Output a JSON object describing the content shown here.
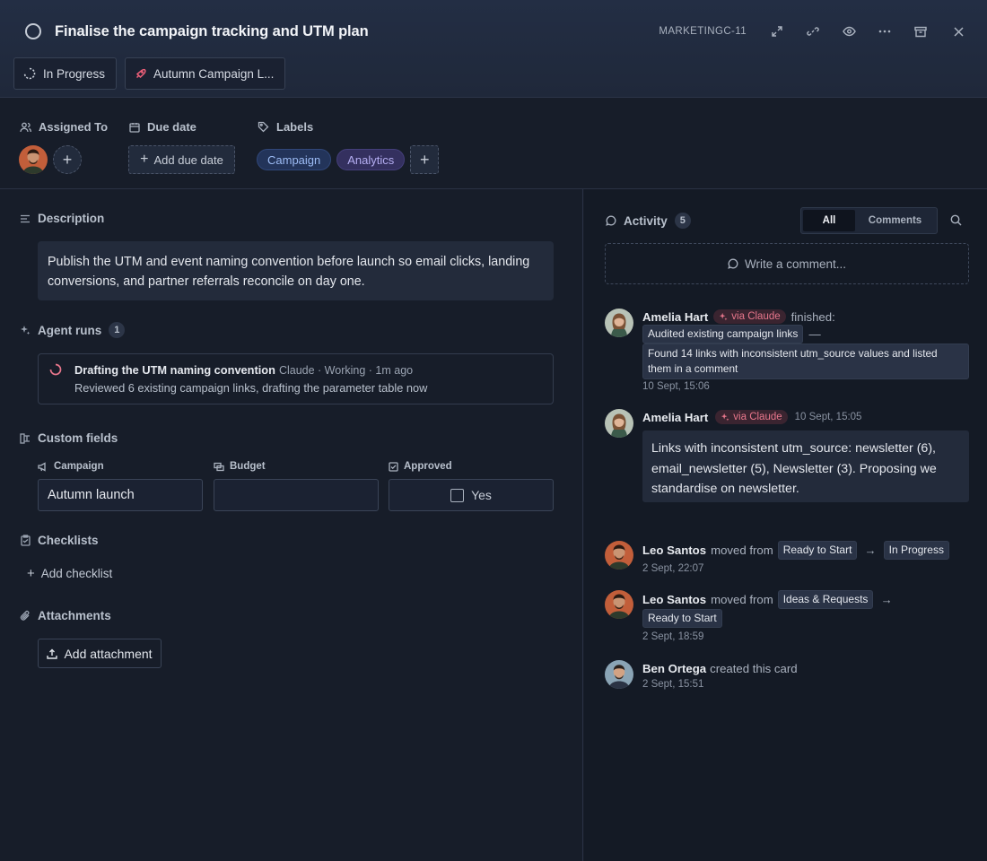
{
  "header": {
    "title": "Finalise the campaign tracking and UTM plan",
    "card_id": "MARKETINGC-11",
    "chips": [
      {
        "label": "In Progress",
        "icon": "progress-icon"
      },
      {
        "label": "Autumn Campaign L...",
        "icon": "rocket-icon",
        "icon_color": "#f0607a"
      }
    ]
  },
  "meta": {
    "assigned_label": "Assigned To",
    "due_label": "Due date",
    "due_button": "Add due date",
    "labels_label": "Labels",
    "labels": [
      {
        "text": "Campaign",
        "bg": "#23345a",
        "fg": "#9dbcf5"
      },
      {
        "text": "Analytics",
        "bg": "#34305f",
        "fg": "#b5aef2"
      }
    ]
  },
  "description": {
    "heading": "Description",
    "text": "Publish the UTM and event naming convention before launch so email clicks, landing conversions, and partner referrals reconcile on day one."
  },
  "agent_runs": {
    "heading": "Agent runs",
    "count": "1",
    "run": {
      "title": "Drafting the UTM naming convention",
      "meta": "Claude · Working · 1m ago",
      "detail": "Reviewed 6 existing campaign links, drafting the parameter table now"
    }
  },
  "custom_fields": {
    "heading": "Custom fields",
    "campaign_label": "Campaign",
    "campaign_value": "Autumn launch",
    "budget_label": "Budget",
    "budget_value": "",
    "approved_label": "Approved",
    "approved_text": "Yes"
  },
  "checklists": {
    "heading": "Checklists",
    "add": "Add checklist"
  },
  "attachments": {
    "heading": "Attachments",
    "add": "Add attachment"
  },
  "activity": {
    "heading": "Activity",
    "count": "5",
    "tab_all": "All",
    "tab_comments": "Comments",
    "write_placeholder": "Write a comment...",
    "items": [
      {
        "name": "Amelia Hart",
        "via": "via Claude",
        "action": "finished:",
        "tag1": "Audited existing campaign links",
        "dash": "—",
        "tag2": "Found 14 links with inconsistent utm_source values and listed them in a comment",
        "time": "10 Sept, 15:06"
      },
      {
        "name": "Amelia Hart",
        "via": "via Claude",
        "time": "10 Sept, 15:05",
        "comment": "Links with inconsistent utm_source: newsletter (6), email_newsletter (5), Newsletter (3). Proposing we standardise on newsletter."
      },
      {
        "name": "Leo Santos",
        "action": "moved from",
        "from": "Ready to Start",
        "arrow": "→",
        "to": "In Progress",
        "time": "2 Sept, 22:07"
      },
      {
        "name": "Leo Santos",
        "action": "moved from",
        "from": "Ideas & Requests",
        "arrow": "→",
        "to": "Ready to Start",
        "time": "2 Sept, 18:59"
      },
      {
        "name": "Ben Ortega",
        "action": "created this card",
        "time": "2 Sept, 15:51"
      }
    ]
  }
}
